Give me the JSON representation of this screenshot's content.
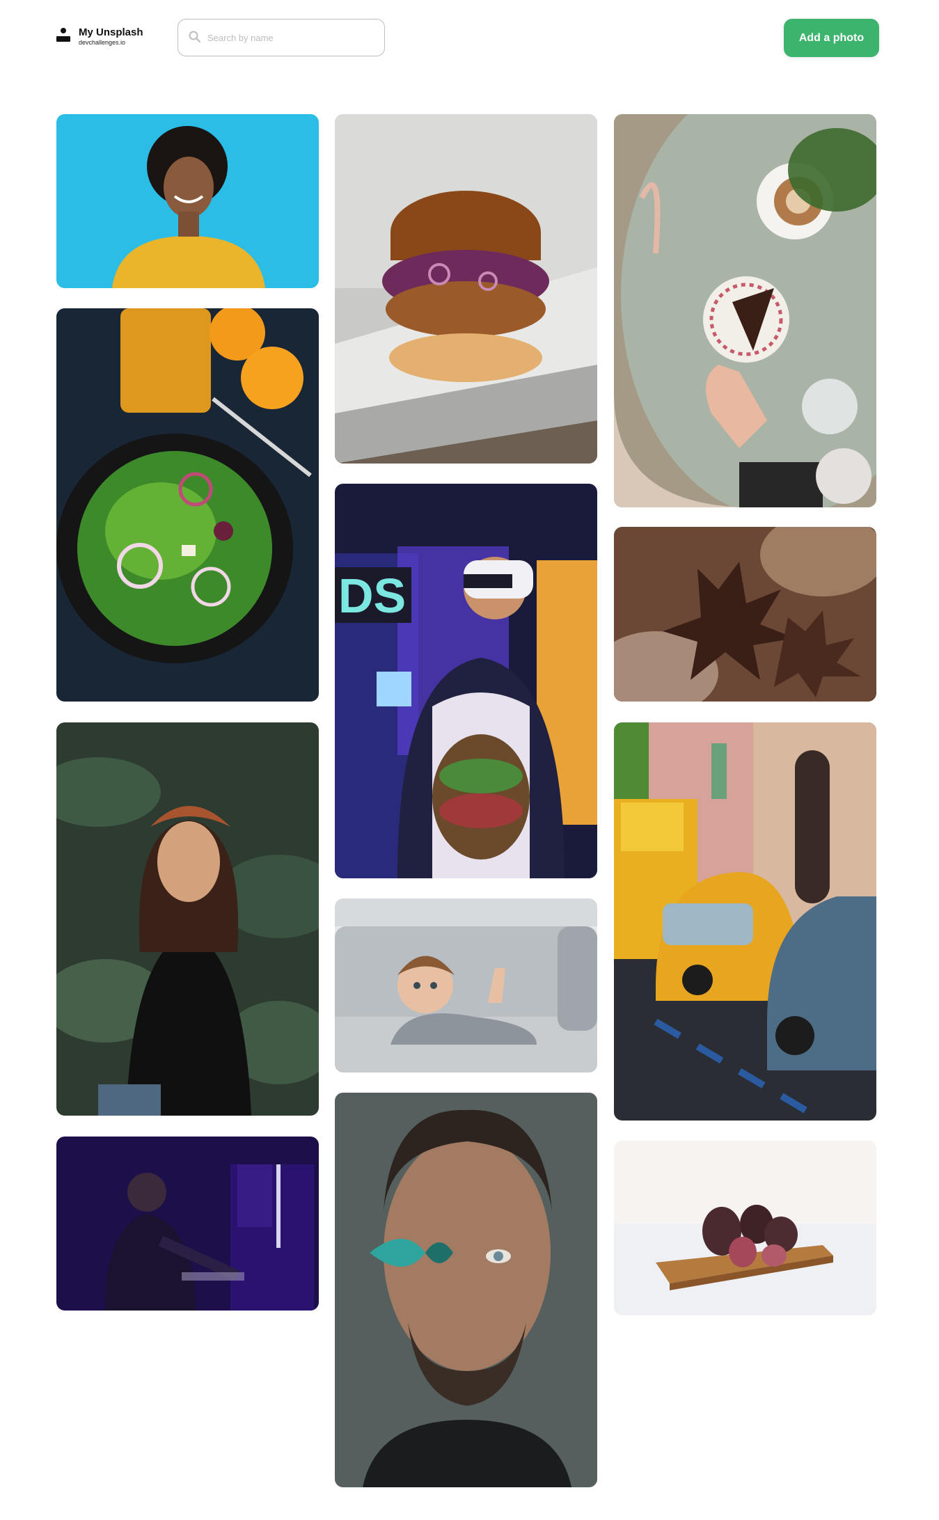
{
  "header": {
    "logo_title": "My Unsplash",
    "logo_subtitle": "devchallenges.io",
    "search_placeholder": "Search by name",
    "search_value": "",
    "add_button_label": "Add a photo"
  },
  "colors": {
    "accent": "#3db46d",
    "border": "#bdbdbd",
    "text": "#111111"
  },
  "icons": {
    "logo": "user-logo-icon",
    "search": "search-icon"
  },
  "gallery": {
    "columns": 3,
    "photos": [
      {
        "subject": "smiling woman with curly hair on blue wall"
      },
      {
        "subject": "salad bowl with orange juice"
      },
      {
        "subject": "woman with headscarf among leaves"
      },
      {
        "subject": "man at computer in purple light"
      },
      {
        "subject": "burger on white plate"
      },
      {
        "subject": "boy wearing VR headset"
      },
      {
        "subject": "little girl lying on couch"
      },
      {
        "subject": "man with butterfly over eye"
      },
      {
        "subject": "coffee and cake on table"
      },
      {
        "subject": "autumn maple leaves"
      },
      {
        "subject": "yellow vintage cars on street"
      },
      {
        "subject": "figs on wooden board"
      }
    ]
  }
}
